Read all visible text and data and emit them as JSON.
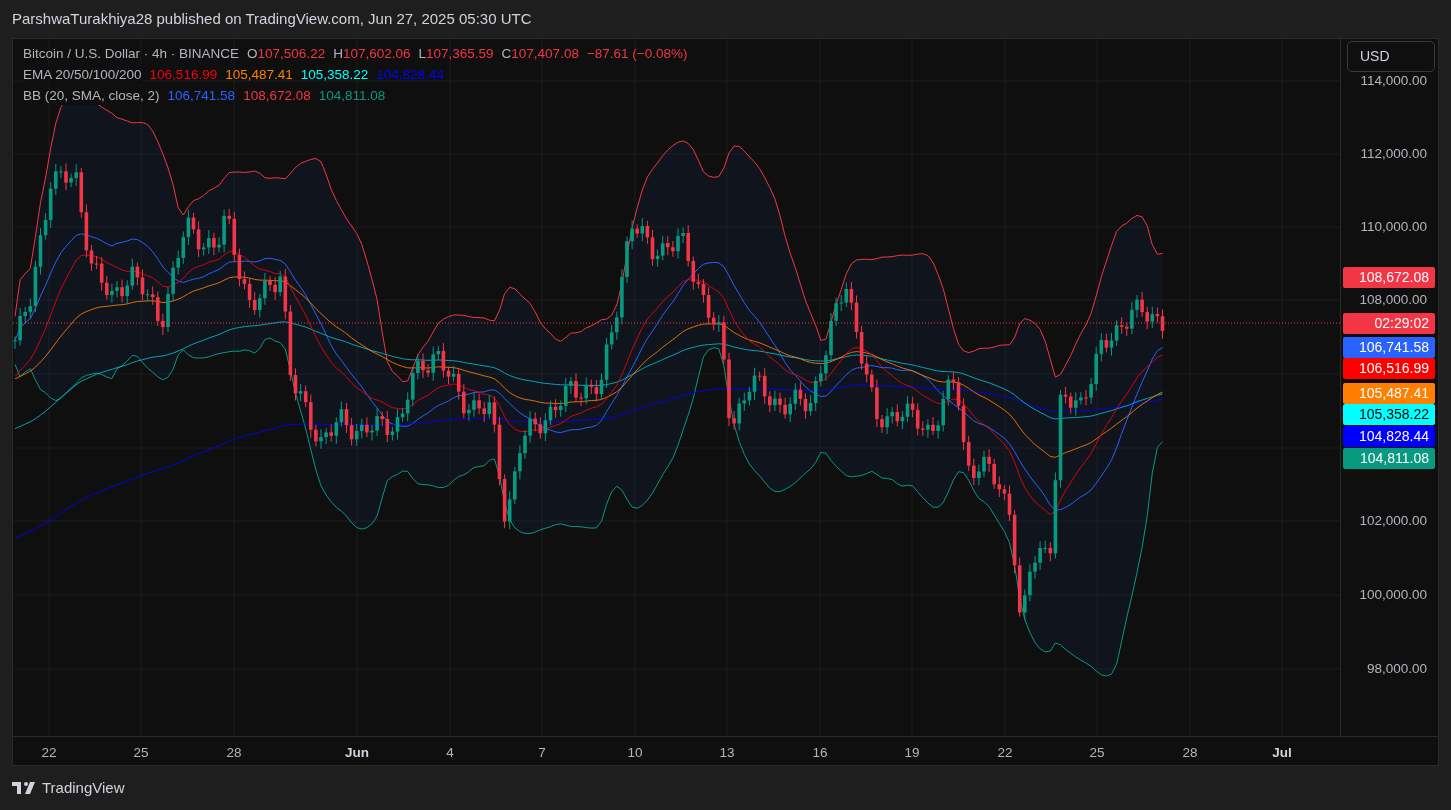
{
  "header": {
    "attribution": "ParshwaTurakhiya28 published on TradingView.com, Jun 27, 2025 05:30 UTC"
  },
  "legend": {
    "symbol": "Bitcoin / U.S. Dollar · 4h · BINANCE",
    "ohlc": [
      {
        "label": "O",
        "value": "107,506.22"
      },
      {
        "label": "H",
        "value": "107,602.06"
      },
      {
        "label": "L",
        "value": "107,365.59"
      },
      {
        "label": "C",
        "value": "107,407.08"
      }
    ],
    "change": "−87.61 (−0.08%)",
    "indicators": [
      {
        "name": "EMA 20/50/100/200",
        "values": [
          {
            "text": "106,516.99",
            "color": "#f7000f"
          },
          {
            "text": "105,487.41",
            "color": "#ff7f00"
          },
          {
            "text": "105,358.22",
            "color": "#00ffff"
          },
          {
            "text": "104,828.44",
            "color": "#0000ff"
          }
        ]
      },
      {
        "name": "BB (20, SMA, close, 2)",
        "values": [
          {
            "text": "106,741.58",
            "color": "#2962ff"
          },
          {
            "text": "108,672.08",
            "color": "#f23645"
          },
          {
            "text": "104,811.08",
            "color": "#089981"
          }
        ]
      }
    ]
  },
  "price_axis": {
    "currency": "USD",
    "ticks": [
      "114,000.00",
      "112,000.00",
      "110,000.00",
      "108,000.00",
      "102,000.00",
      "100,000.00",
      "98,000.00"
    ],
    "badges": [
      {
        "text": "108,672.08",
        "color": "#f23645"
      },
      {
        "text": "02:29:02",
        "color": "#f23645"
      },
      {
        "text": "106,741.58",
        "color": "#2962ff"
      },
      {
        "text": "106,516.99",
        "color": "#ff0000"
      },
      {
        "text": "105,487.41",
        "color": "#ff7f00"
      },
      {
        "text": "105,358.22",
        "color": "#00ffff"
      },
      {
        "text": "104,828.44",
        "color": "#0000ff"
      },
      {
        "text": "104,811.08",
        "color": "#089981"
      }
    ]
  },
  "time_axis": [
    {
      "label": "22",
      "kind": "day"
    },
    {
      "label": "25",
      "kind": "day"
    },
    {
      "label": "28",
      "kind": "day"
    },
    {
      "label": "Jun",
      "kind": "month"
    },
    {
      "label": "4",
      "kind": "day"
    },
    {
      "label": "7",
      "kind": "day"
    },
    {
      "label": "10",
      "kind": "day"
    },
    {
      "label": "13",
      "kind": "day"
    },
    {
      "label": "16",
      "kind": "day"
    },
    {
      "label": "19",
      "kind": "day"
    },
    {
      "label": "22",
      "kind": "day"
    },
    {
      "label": "25",
      "kind": "day"
    },
    {
      "label": "28",
      "kind": "day"
    },
    {
      "label": "Jul",
      "kind": "month"
    }
  ],
  "footer": {
    "brand": "TradingView"
  }
}
